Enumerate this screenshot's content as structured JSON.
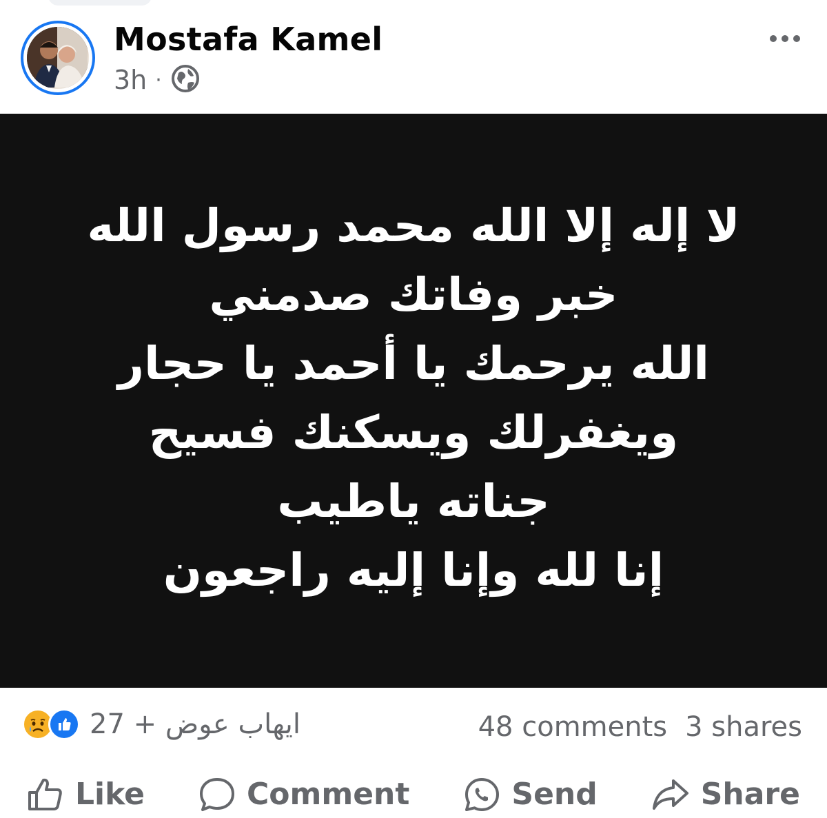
{
  "post": {
    "author": "Mostafa Kamel",
    "time": "3h",
    "separator": "·",
    "audience_icon": "globe-icon",
    "more_label": "•••"
  },
  "image_text": {
    "lines": [
      "لا إله إلا الله محمد رسول الله",
      "خبر وفاتك صدمني",
      "الله يرحمك يا أحمد يا حجار",
      "ويغفرلك ويسكنك فسيح",
      "جناته ياطيب",
      "إنا لله وإنا إليه راجعون"
    ]
  },
  "stats": {
    "reactions_text": "ايهاب عوض + 27",
    "reaction_icons": [
      "like-icon",
      "sad-icon"
    ],
    "comments": "48 comments",
    "shares": "3 shares"
  },
  "actions": {
    "like": "Like",
    "comment": "Comment",
    "send": "Send",
    "share": "Share"
  },
  "colors": {
    "accent": "#1877f2",
    "muted": "#65676b",
    "image_bg": "#111111"
  }
}
